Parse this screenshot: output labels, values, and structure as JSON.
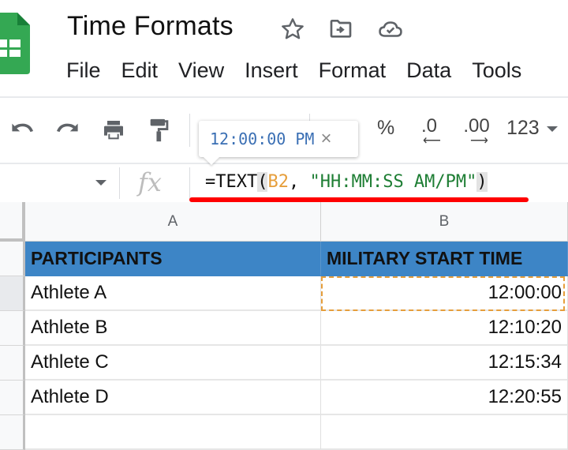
{
  "app": {
    "document_title": "Time Formats",
    "title_icons": [
      "star-icon",
      "move-to-folder-icon",
      "cloud-saved-icon"
    ]
  },
  "menu": {
    "items": [
      "File",
      "Edit",
      "View",
      "Insert",
      "Format",
      "Data",
      "Tools"
    ]
  },
  "toolbar": {
    "icons": [
      "undo-icon",
      "redo-icon",
      "print-icon",
      "paint-format-icon"
    ],
    "percent_label": "%",
    "decrease_decimal_label": ".0",
    "increase_decimal_label": ".00",
    "number_format_label": "123"
  },
  "formula_bar": {
    "fx_label": "fx",
    "formula_prefix": "=TEXT",
    "open_paren": "(",
    "cell_ref": "B2",
    "separator": ", ",
    "format_string": "\"HH:MM:SS AM/PM\"",
    "close_paren": ")"
  },
  "tooltip": {
    "value": "12:00:00 PM",
    "close_glyph": "×"
  },
  "grid": {
    "columns": [
      "A",
      "B"
    ],
    "header_row": [
      "PARTICIPANTS",
      "MILITARY START TIME"
    ],
    "header_color": "#3d85c6",
    "rows": [
      {
        "participant": "Athlete A",
        "start_time": "12:00:00"
      },
      {
        "participant": "Athlete B",
        "start_time": "12:10:20"
      },
      {
        "participant": "Athlete C",
        "start_time": "12:15:34"
      },
      {
        "participant": "Athlete D",
        "start_time": "12:20:55"
      },
      {
        "participant": "",
        "start_time": ""
      }
    ],
    "selected_cell": "B2"
  },
  "colors": {
    "accent_red_underline": "#ff0000",
    "cell_ref_color": "#e69e3b",
    "string_color": "#1e7e34",
    "tooltip_text": "#3a6fb4",
    "logo_green": "#34a853"
  }
}
